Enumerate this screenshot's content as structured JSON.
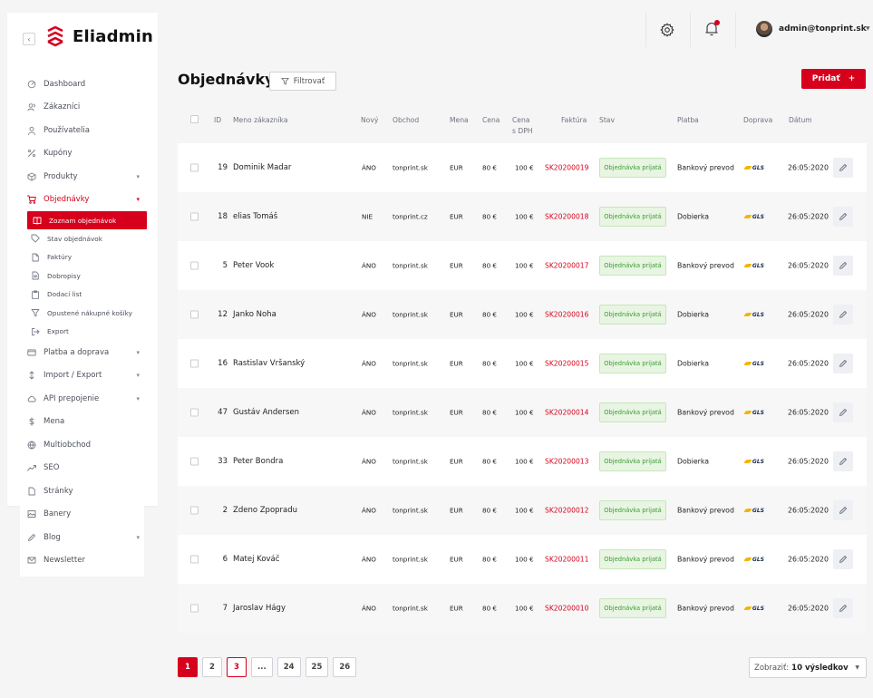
{
  "brand": {
    "name": "Eliadmin",
    "collapse_icon": "‹"
  },
  "topbar": {
    "user": "admin@tonprint.sk"
  },
  "nav": {
    "items": [
      {
        "label": "Dashboard",
        "icon": "dashboard-icon"
      },
      {
        "label": "Zákazníci",
        "icon": "customers-icon"
      },
      {
        "label": "Používatelia",
        "icon": "users-icon"
      },
      {
        "label": "Kupóny",
        "icon": "percent-icon"
      },
      {
        "label": "Produkty",
        "icon": "box-icon",
        "chevron": "▾"
      },
      {
        "label": "Objednávky",
        "icon": "cart-icon",
        "chevron": "▾"
      }
    ],
    "sub_items": [
      {
        "label": "Zoznam objednávok",
        "icon": "book-icon"
      },
      {
        "label": "Stav objednávok",
        "icon": "tag-icon"
      },
      {
        "label": "Faktúry",
        "icon": "file-icon"
      },
      {
        "label": "Dobropisy",
        "icon": "doc-icon"
      },
      {
        "label": "Dodací list",
        "icon": "clipboard-icon"
      },
      {
        "label": "Opustené nákupné košíky",
        "icon": "filter-icon"
      },
      {
        "label": "Export",
        "icon": "export-icon"
      }
    ],
    "items2": [
      {
        "label": "Platba a doprava",
        "icon": "card-icon",
        "chevron": "▾"
      },
      {
        "label": "Import / Export",
        "icon": "sort-icon",
        "chevron": "▾"
      },
      {
        "label": "API prepojenie",
        "icon": "cloud-icon",
        "chevron": "▾"
      },
      {
        "label": "Mena",
        "icon": "dollar-icon"
      },
      {
        "label": "Multiobchod",
        "icon": "globe-icon"
      },
      {
        "label": "SEO",
        "icon": "trend-icon"
      },
      {
        "label": "Stránky",
        "icon": "page-icon"
      },
      {
        "label": "Banery",
        "icon": "image-icon"
      },
      {
        "label": "Blog",
        "icon": "pen-icon",
        "chevron": "▾"
      },
      {
        "label": "Newsletter",
        "icon": "mail-icon"
      }
    ]
  },
  "page": {
    "title": "Objednávky",
    "filter_label": "Filtrovať",
    "add_label": "Pridať",
    "add_icon": "+"
  },
  "table": {
    "headers": {
      "id": "ID",
      "name": "Meno zákazníka",
      "novy": "Nový",
      "obchod": "Obchod",
      "mena": "Mena",
      "cena": "Cena",
      "cena_sdph_1": "Cena",
      "cena_sdph_2": "s DPH",
      "faktura": "Faktúra",
      "stav": "Stav",
      "platba": "Platba",
      "doprava": "Doprava",
      "datum": "Dátum"
    },
    "rows": [
      {
        "id": "19",
        "name": "Dominik Madar",
        "novy": "ÁNO",
        "obchod": "tonprint.sk",
        "mena": "EUR",
        "cena": "80 €",
        "sdph": "100 €",
        "faktura": "SK20200019",
        "stav": "Objednávka prijatá",
        "platba": "Bankový prevod",
        "doprava": "GLS",
        "datum": "26:05:2020"
      },
      {
        "id": "18",
        "name": "elias Tomáš",
        "novy": "NIE",
        "obchod": "tonprint.cz",
        "mena": "EUR",
        "cena": "80 €",
        "sdph": "100 €",
        "faktura": "SK20200018",
        "stav": "Objednávka prijatá",
        "platba": "Dobierka",
        "doprava": "GLS",
        "datum": "26:05:2020"
      },
      {
        "id": "5",
        "name": "Peter Vook",
        "novy": "ÁNO",
        "obchod": "tonprint.sk",
        "mena": "EUR",
        "cena": "80 €",
        "sdph": "100 €",
        "faktura": "SK20200017",
        "stav": "Objednávka prijatá",
        "platba": "Bankový prevod",
        "doprava": "GLS",
        "datum": "26:05:2020"
      },
      {
        "id": "12",
        "name": "Janko Noha",
        "novy": "ÁNO",
        "obchod": "tonprint.sk",
        "mena": "EUR",
        "cena": "80 €",
        "sdph": "100 €",
        "faktura": "SK20200016",
        "stav": "Objednávka prijatá",
        "platba": "Dobierka",
        "doprava": "GLS",
        "datum": "26:05:2020"
      },
      {
        "id": "16",
        "name": "Rastislav Vršanský",
        "novy": "ÁNO",
        "obchod": "tonprint.sk",
        "mena": "EUR",
        "cena": "80 €",
        "sdph": "100 €",
        "faktura": "SK20200015",
        "stav": "Objednávka prijatá",
        "platba": "Dobierka",
        "doprava": "GLS",
        "datum": "26:05:2020"
      },
      {
        "id": "47",
        "name": "Gustáv Andersen",
        "novy": "ÁNO",
        "obchod": "tonprint.sk",
        "mena": "EUR",
        "cena": "80 €",
        "sdph": "100 €",
        "faktura": "SK20200014",
        "stav": "Objednávka prijatá",
        "platba": "Bankový prevod",
        "doprava": "GLS",
        "datum": "26:05:2020"
      },
      {
        "id": "33",
        "name": "Peter Bondra",
        "novy": "ÁNO",
        "obchod": "tonprint.sk",
        "mena": "EUR",
        "cena": "80 €",
        "sdph": "100 €",
        "faktura": "SK20200013",
        "stav": "Objednávka prijatá",
        "platba": "Dobierka",
        "doprava": "GLS",
        "datum": "26:05:2020"
      },
      {
        "id": "2",
        "name": "Zdeno Zpopradu",
        "novy": "ÁNO",
        "obchod": "tonprint.sk",
        "mena": "EUR",
        "cena": "80 €",
        "sdph": "100 €",
        "faktura": "SK20200012",
        "stav": "Objednávka prijatá",
        "platba": "Bankový prevod",
        "doprava": "GLS",
        "datum": "26:05:2020"
      },
      {
        "id": "6",
        "name": "Matej Kováč",
        "novy": "ÁNO",
        "obchod": "tonprint.sk",
        "mena": "EUR",
        "cena": "80 €",
        "sdph": "100 €",
        "faktura": "SK20200011",
        "stav": "Objednávka prijatá",
        "platba": "Bankový prevod",
        "doprava": "GLS",
        "datum": "26:05:2020"
      },
      {
        "id": "7",
        "name": "Jaroslav Hágy",
        "novy": "ÁNO",
        "obchod": "tonprint.sk",
        "mena": "EUR",
        "cena": "80 €",
        "sdph": "100 €",
        "faktura": "SK20200010",
        "stav": "Objednávka prijatá",
        "platba": "Bankový prevod",
        "doprava": "GLS",
        "datum": "26:05:2020"
      }
    ]
  },
  "pager": {
    "pages": [
      {
        "label": "1",
        "state": "active"
      },
      {
        "label": "2",
        "state": "normal"
      },
      {
        "label": "3",
        "state": "red"
      },
      {
        "label": "...",
        "state": "normal"
      },
      {
        "label": "24",
        "state": "normal"
      },
      {
        "label": "25",
        "state": "normal"
      },
      {
        "label": "26",
        "state": "normal"
      }
    ],
    "per_page_prefix": "Zobraziť:",
    "per_page_value": "10 výsledkov"
  },
  "colors": {
    "accent": "#d6001c",
    "status_bg": "#e8f5e2",
    "status_text": "#3b9b35"
  }
}
